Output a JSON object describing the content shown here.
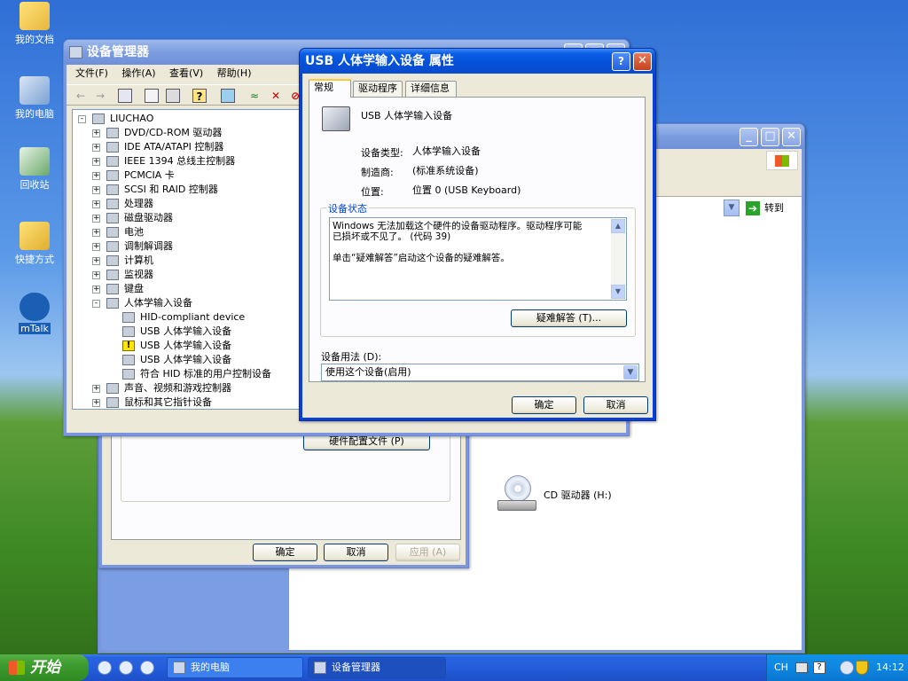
{
  "desktop": {
    "icons": [
      {
        "label": "我的文档"
      },
      {
        "label": "我的电脑"
      },
      {
        "label": "回收站"
      },
      {
        "label": "快捷方式"
      },
      {
        "label": "mTalk"
      }
    ]
  },
  "explorer": {
    "goto_label": "转到",
    "drive_label": "CD 驱动器 (H:)"
  },
  "sysprops": {
    "hwprofile_button": "硬件配置文件 (P)",
    "ok_label": "确定",
    "cancel_label": "取消",
    "apply_label": "应用 (A)"
  },
  "devmgr": {
    "title": "设备管理器",
    "menu": [
      "文件(F)",
      "操作(A)",
      "查看(V)",
      "帮助(H)"
    ],
    "tree": [
      {
        "label": "LIUCHAO",
        "level": 0,
        "expander": "-"
      },
      {
        "label": "DVD/CD-ROM 驱动器",
        "level": 1,
        "expander": "+"
      },
      {
        "label": "IDE ATA/ATAPI 控制器",
        "level": 1,
        "expander": "+"
      },
      {
        "label": "IEEE 1394 总线主控制器",
        "level": 1,
        "expander": "+"
      },
      {
        "label": "PCMCIA 卡",
        "level": 1,
        "expander": "+"
      },
      {
        "label": "SCSI 和 RAID 控制器",
        "level": 1,
        "expander": "+"
      },
      {
        "label": "处理器",
        "level": 1,
        "expander": "+"
      },
      {
        "label": "磁盘驱动器",
        "level": 1,
        "expander": "+"
      },
      {
        "label": "电池",
        "level": 1,
        "expander": "+"
      },
      {
        "label": "调制解调器",
        "level": 1,
        "expander": "+"
      },
      {
        "label": "计算机",
        "level": 1,
        "expander": "+"
      },
      {
        "label": "监视器",
        "level": 1,
        "expander": "+"
      },
      {
        "label": "键盘",
        "level": 1,
        "expander": "+"
      },
      {
        "label": "人体学输入设备",
        "level": 1,
        "expander": "-"
      },
      {
        "label": "HID-compliant device",
        "level": 2,
        "expander": ""
      },
      {
        "label": "USB 人体学输入设备",
        "level": 2,
        "expander": ""
      },
      {
        "label": "USB 人体学输入设备",
        "level": 2,
        "expander": "",
        "warning": true
      },
      {
        "label": "USB 人体学输入设备",
        "level": 2,
        "expander": ""
      },
      {
        "label": "符合 HID 标准的用户控制设备",
        "level": 2,
        "expander": ""
      },
      {
        "label": "声音、视频和游戏控制器",
        "level": 1,
        "expander": "+"
      },
      {
        "label": "鼠标和其它指针设备",
        "level": 1,
        "expander": "+"
      }
    ]
  },
  "dialog": {
    "title": "USB 人体学输入设备 属性",
    "tabs": [
      "常规",
      "驱动程序",
      "详细信息"
    ],
    "device_name": "USB 人体学输入设备",
    "type_label": "设备类型:",
    "type_value": "人体学输入设备",
    "mfr_label": "制造商:",
    "mfr_value": "(标准系统设备)",
    "loc_label": "位置:",
    "loc_value": "位置 0 (USB Keyboard)",
    "status_group": "设备状态",
    "status_line1": "Windows 无法加载这个硬件的设备驱动程序。驱动程序可能",
    "status_line2": "已损坏或不见了。 (代码 39)",
    "status_line3": "单击“疑难解答”启动这个设备的疑难解答。",
    "troubleshoot_label": "疑难解答 (T)...",
    "usage_label": "设备用法 (D):",
    "usage_value": "使用这个设备(启用)",
    "ok_label": "确定",
    "cancel_label": "取消"
  },
  "taskbar": {
    "start_label": "开始",
    "tasks": [
      "我的电脑",
      "设备管理器"
    ],
    "lang": "CH",
    "clock": "14:12"
  }
}
